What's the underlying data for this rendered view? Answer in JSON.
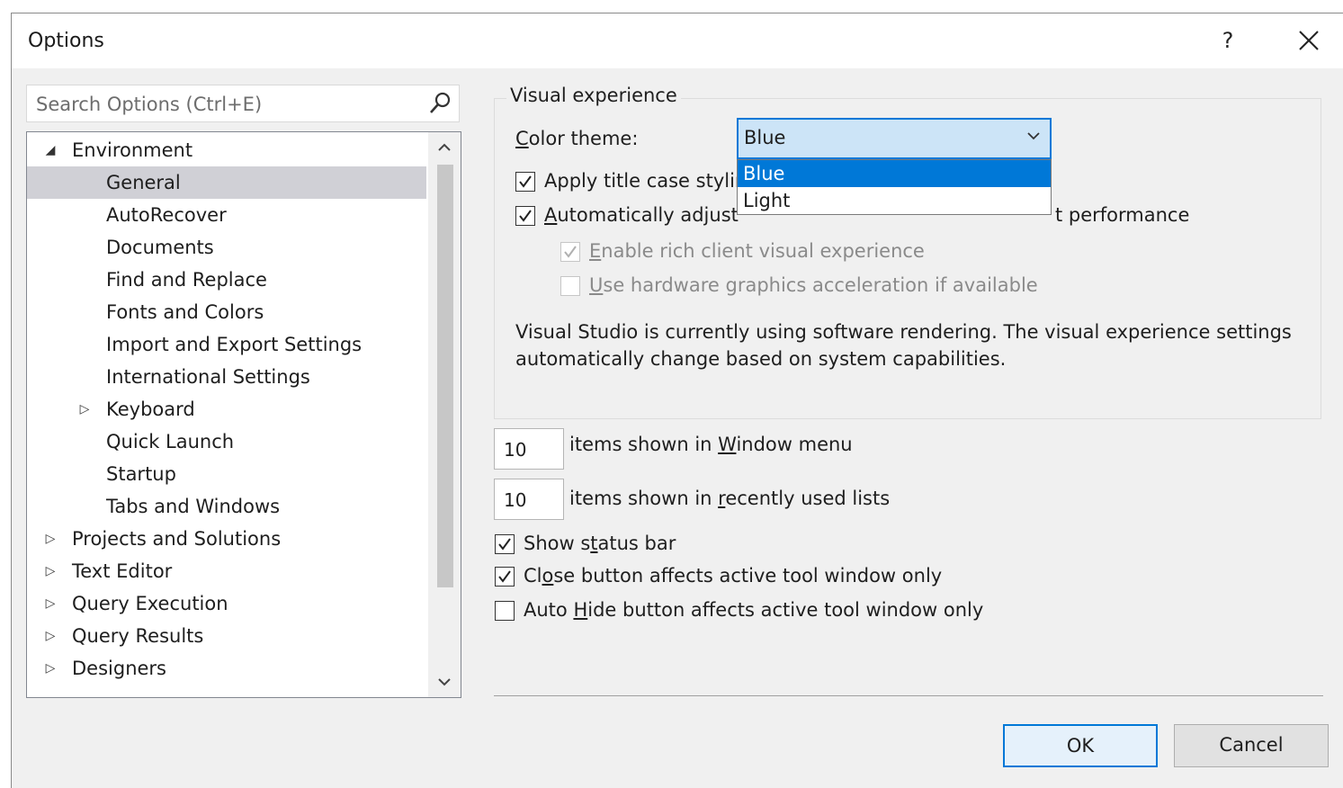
{
  "window": {
    "title": "Options",
    "help_label": "?",
    "close_label": "✕"
  },
  "search": {
    "placeholder": "Search Options (Ctrl+E)"
  },
  "tree": {
    "items": [
      {
        "label": "Environment",
        "expanded": true
      },
      {
        "label": "General",
        "selected": true
      },
      {
        "label": "AutoRecover"
      },
      {
        "label": "Documents"
      },
      {
        "label": "Find and Replace"
      },
      {
        "label": "Fonts and Colors"
      },
      {
        "label": "Import and Export Settings"
      },
      {
        "label": "International Settings"
      },
      {
        "label": "Keyboard",
        "expanded": false
      },
      {
        "label": "Quick Launch"
      },
      {
        "label": "Startup"
      },
      {
        "label": "Tabs and Windows"
      },
      {
        "label": "Projects and Solutions",
        "expanded": false
      },
      {
        "label": "Text Editor",
        "expanded": false
      },
      {
        "label": "Query Execution",
        "expanded": false
      },
      {
        "label": "Query Results",
        "expanded": false
      },
      {
        "label": "Designers",
        "expanded": false
      }
    ]
  },
  "visual_experience": {
    "legend": "Visual experience",
    "color_theme": {
      "label_first": "C",
      "label_rest": "olor theme:",
      "value": "Blue",
      "options": [
        "Blue",
        "Light"
      ]
    },
    "apply_title_case": {
      "label": "Apply title case stylir",
      "checked": true
    },
    "auto_adjust": {
      "label_first": "A",
      "label_rest": "utomatically adjust",
      "label_tail": "t performance",
      "checked": true
    },
    "rich_client": {
      "label_first": "E",
      "label_rest": "nable rich client visual experience",
      "checked": true,
      "disabled": true
    },
    "hardware_accel": {
      "label_first": "U",
      "label_rest": "se hardware graphics acceleration if available",
      "checked": false,
      "disabled": true
    },
    "info_line1": "Visual Studio is currently using software rendering.  The visual experience settings",
    "info_line2": "automatically change based on system capabilities."
  },
  "window_menu": {
    "value": "10",
    "label_pre": "items shown in ",
    "label_key": "W",
    "label_post": "indow menu"
  },
  "recent_lists": {
    "value": "10",
    "label_pre": "items shown in ",
    "label_key": "r",
    "label_post": "ecently used lists"
  },
  "show_status_bar": {
    "label_pre": "Show s",
    "label_key": "t",
    "label_post": "atus bar",
    "checked": true
  },
  "close_button": {
    "label_pre": "Cl",
    "label_key": "o",
    "label_post": "se button affects active tool window only",
    "checked": true
  },
  "auto_hide": {
    "label_pre": "Auto ",
    "label_key": "H",
    "label_post": "ide button affects active tool window only",
    "checked": false
  },
  "buttons": {
    "ok": "OK",
    "cancel": "Cancel"
  }
}
